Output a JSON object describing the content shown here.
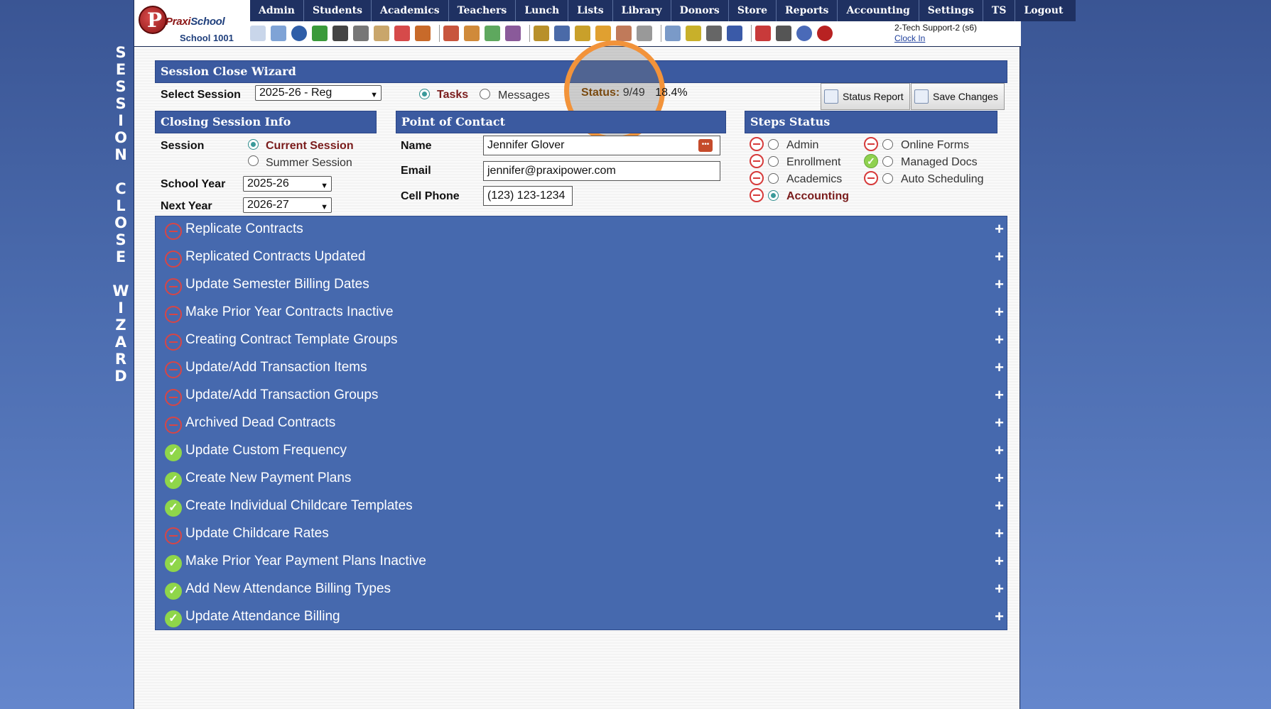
{
  "side_title": [
    "S",
    "E",
    "S",
    "S",
    "I",
    "O",
    "N",
    "",
    "C",
    "L",
    "O",
    "S",
    "E",
    "",
    "W",
    "I",
    "Z",
    "A",
    "R",
    "D"
  ],
  "logo": {
    "brand_a": "Praxi",
    "brand_b": "School",
    "school": "School 1001"
  },
  "menu": [
    "Admin",
    "Students",
    "Academics",
    "Teachers",
    "Lunch",
    "Lists",
    "Library",
    "Donors",
    "Store",
    "Reports",
    "Accounting",
    "Settings",
    "TS",
    "Logout"
  ],
  "toolbar_icons": [
    "search-icon",
    "calendar-grid-icon",
    "at-email-icon",
    "chat-icon",
    "phone-icon",
    "speaker-icon",
    "report-icon",
    "date-icon",
    "megaphone-icon",
    "",
    "user-red-icon",
    "user-orange-icon",
    "money-icon",
    "group-icon",
    "",
    "card-icon",
    "book-icon",
    "wand-icon",
    "arrow-icon",
    "person-icon",
    "tag-icon",
    "",
    "table-icon",
    "barcode-icon",
    "printer-icon",
    "ap-icon",
    "",
    "pdf-icon",
    "stack-icon",
    "help-icon",
    "power-icon"
  ],
  "user": {
    "name": "2-Tech Support-2 (s6)",
    "clock": "Clock In"
  },
  "wizard": {
    "title": "Session Close Wizard",
    "select_session_label": "Select Session",
    "select_session_value": "2025-26 - Reg",
    "tasks_label": "Tasks",
    "messages_label": "Messages",
    "status_label": "Status:",
    "status_value": "9/49",
    "status_pct": "18.4%",
    "status_report": "Status Report",
    "save_changes": "Save Changes"
  },
  "closing": {
    "title": "Closing Session Info",
    "session_label": "Session",
    "current_session": "Current Session",
    "summer_session": "Summer Session",
    "school_year_label": "School Year",
    "school_year_value": "2025-26",
    "next_year_label": "Next Year",
    "next_year_value": "2026-27"
  },
  "contact": {
    "title": "Point of Contact",
    "name_label": "Name",
    "name_value": "Jennifer Glover",
    "email_label": "Email",
    "email_value": "jennifer@praxipower.com",
    "phone_label": "Cell Phone",
    "phone_value": "(123) 123-1234"
  },
  "steps": {
    "title": "Steps Status",
    "items": [
      {
        "label": "Admin",
        "done": false,
        "selected": false
      },
      {
        "label": "Enrollment",
        "done": false,
        "selected": false
      },
      {
        "label": "Academics",
        "done": false,
        "selected": false
      },
      {
        "label": "Accounting",
        "done": false,
        "selected": true
      },
      {
        "label": "Online Forms",
        "done": false,
        "selected": false
      },
      {
        "label": "Managed Docs",
        "done": true,
        "selected": false
      },
      {
        "label": "Auto Scheduling",
        "done": false,
        "selected": false
      }
    ]
  },
  "task_list": [
    {
      "label": "Replicate Contracts",
      "done": false
    },
    {
      "label": "Replicated Contracts Updated",
      "done": false
    },
    {
      "label": "Update Semester Billing Dates",
      "done": false
    },
    {
      "label": "Make Prior Year Contracts Inactive",
      "done": false
    },
    {
      "label": "Creating Contract Template Groups",
      "done": false
    },
    {
      "label": "Update/Add Transaction Items",
      "done": false
    },
    {
      "label": "Update/Add Transaction Groups",
      "done": false
    },
    {
      "label": "Archived Dead Contracts",
      "done": false
    },
    {
      "label": "Update Custom Frequency",
      "done": true
    },
    {
      "label": "Create New Payment Plans",
      "done": true
    },
    {
      "label": "Create Individual Childcare Templates",
      "done": true
    },
    {
      "label": "Update Childcare Rates",
      "done": false
    },
    {
      "label": "Make Prior Year Payment Plans Inactive",
      "done": true
    },
    {
      "label": "Add New Attendance Billing Types",
      "done": true
    },
    {
      "label": "Update Attendance Billing",
      "done": true
    }
  ],
  "plus_symbol": "+",
  "check_symbol": "✓",
  "colors": {
    "accent": "#3b5aa0",
    "done": "#8fd64a",
    "pending": "#d84545",
    "highlight": "#f2933a"
  }
}
